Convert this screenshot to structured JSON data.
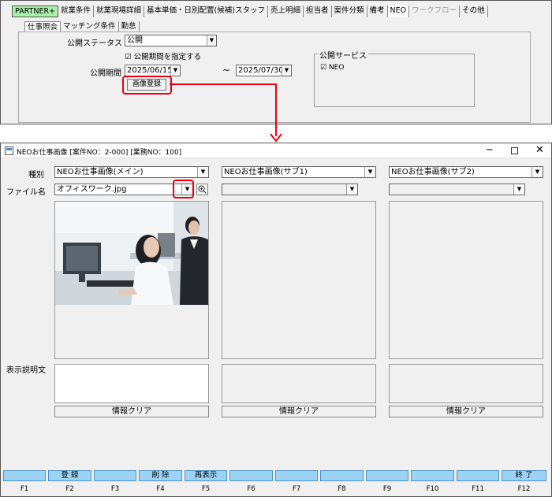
{
  "top": {
    "tabs": [
      "PARTNER+",
      "就業条件",
      "就業現場詳細",
      "基本単価・日別配置(候補)スタッフ",
      "売上明細",
      "担当者",
      "案件分類",
      "備考",
      "NEO",
      "ワークフロー",
      "その他"
    ],
    "subtabs": [
      "仕事照会",
      "マッチング条件",
      "勤怠"
    ],
    "status_label": "公開ステータス",
    "status_value": "公開",
    "period_checkbox_label": "公開期間を指定する",
    "period_label": "公開期間",
    "period_start": "2025/06/15",
    "period_tilde": "~",
    "period_end": "2025/07/30",
    "image_register_button": "画像登録",
    "service_group_label": "公開サービス",
    "service_neo_label": "NEO"
  },
  "dialog": {
    "title": "NEOお仕事画像 [案件NO：2-000] [業務NO：100]",
    "kind_label": "種別",
    "file_label": "ファイル名",
    "desc_label": "表示説明文",
    "columns": [
      {
        "kind": "NEOお仕事画像(メイン)",
        "file": "オフィスワーク.jpg",
        "clear": "情報クリア"
      },
      {
        "kind": "NEOお仕事画像(サブ1)",
        "file": "",
        "clear": "情報クリア"
      },
      {
        "kind": "NEOお仕事画像(サブ2)",
        "file": "",
        "clear": "情報クリア"
      }
    ],
    "fkeys": [
      {
        "label": "",
        "key": "F1"
      },
      {
        "label": "登 録",
        "key": "F2"
      },
      {
        "label": "",
        "key": "F3"
      },
      {
        "label": "削 除",
        "key": "F4"
      },
      {
        "label": "再表示",
        "key": "F5"
      },
      {
        "label": "",
        "key": "F6"
      },
      {
        "label": "",
        "key": "F7"
      },
      {
        "label": "",
        "key": "F8"
      },
      {
        "label": "",
        "key": "F9"
      },
      {
        "label": "",
        "key": "F10"
      },
      {
        "label": "",
        "key": "F11"
      },
      {
        "label": "終 了",
        "key": "F12"
      }
    ]
  },
  "colors": {
    "highlight": "#e8000f",
    "fkey": "#9cd3f5",
    "partner_tab": "#a9f0a9"
  }
}
